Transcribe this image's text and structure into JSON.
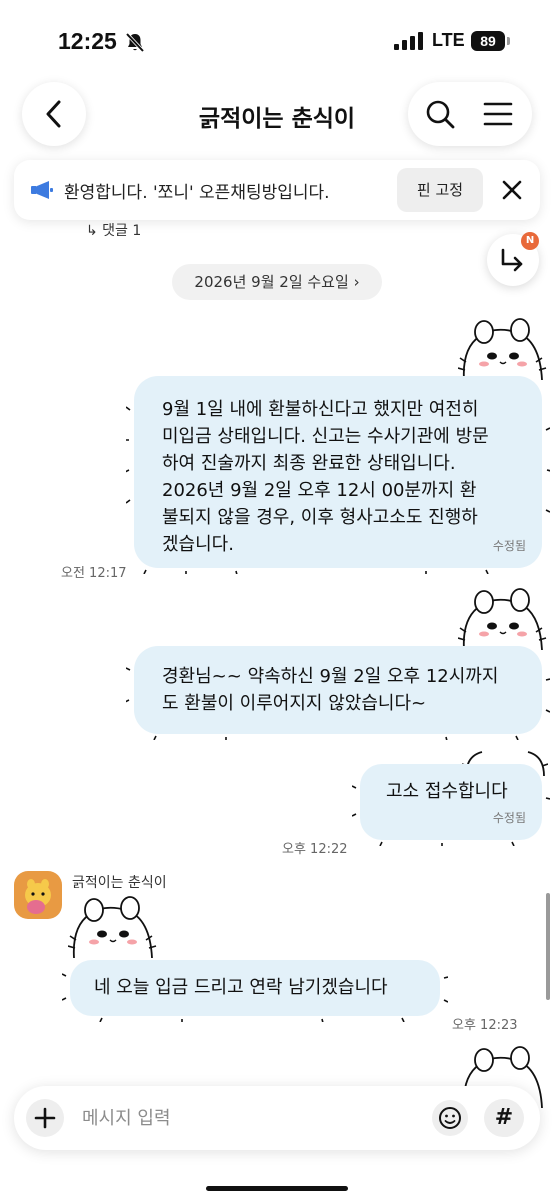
{
  "status_bar": {
    "time": "12:25",
    "network": "LTE",
    "battery": "89"
  },
  "header": {
    "title": "긁적이는 춘식이"
  },
  "notice": {
    "text": "환영합니다. '쪼니' 오픈채팅방입니다.",
    "pin_label": "핀 고정"
  },
  "reply_count": "↳ 댓글 1",
  "reply_badge": "N",
  "date_separator": "2026년 9월 2일 수요일",
  "messages": [
    {
      "lines": [
        "9월 1일 내에 환불하신다고 했지만 여전히",
        "미입금 상태입니다. 신고는 수사기관에 방문",
        "하여 진술까지 최종 완료한 상태입니다.",
        "2026년 9월 2일 오후 12시 00분까지 환",
        "불되지 않을 경우, 이후 형사고소도 진행하",
        "겠습니다."
      ],
      "edited": "수정됨",
      "time": "오전 12:17"
    },
    {
      "lines": [
        "경환님~~ 약속하신 9월 2일 오후 12시까지",
        "도 환불이 이루어지지 않았습니다~"
      ]
    },
    {
      "lines": [
        "고소 접수합니다"
      ],
      "edited": "수정됨",
      "time": "오후 12:22"
    },
    {
      "sender": "긁적이는 춘식이",
      "lines": [
        "네 오늘 입금 드리고 연락 남기겠습니다"
      ],
      "time": "오후 12:23"
    }
  ],
  "composer": {
    "placeholder": "메시지 입력",
    "hash_label": "#"
  }
}
